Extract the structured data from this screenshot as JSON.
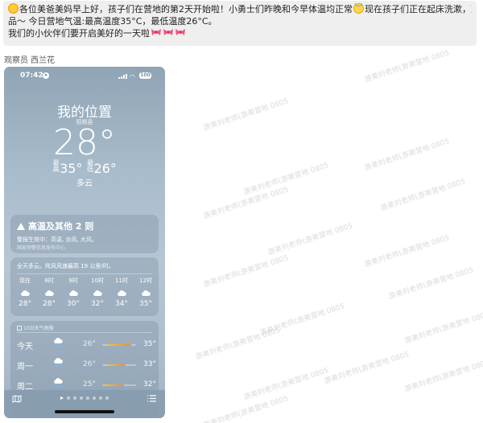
{
  "message": {
    "line1": "各位美爸美妈早上好，孩子们在营地的第2天开始啦！小勇士们昨晚和今早体温均正常",
    "line1b": "现在孩子们正在起床洗漱，准备上午所需物",
    "line2": "品～ 今日营地气温:最高温度35°C，最低温度26°C。",
    "line3": "我们的小伙伴们要开启美好的一天啦"
  },
  "sender": "观察员 西兰花",
  "phone": {
    "status": {
      "time": "07:42",
      "battery": "100"
    },
    "city": "我的位置",
    "subcity": "阳朔县",
    "temp": "28°",
    "high_label": "最高",
    "high": "35°",
    "low_label": "最低",
    "low": "26°",
    "condition": "多云",
    "alert": {
      "title": "高温及其他 2 则",
      "body": "警报生效中：高温, 台风, 大风。",
      "source": "国家预警信息发布中心"
    },
    "hourly": {
      "summary": "全天多云。阵风风速最高 19 公里/时。",
      "hours": [
        {
          "time": "现在",
          "temp": "28°"
        },
        {
          "time": "8时",
          "temp": "28°"
        },
        {
          "time": "9时",
          "temp": "30°"
        },
        {
          "time": "10时",
          "temp": "32°"
        },
        {
          "time": "11时",
          "temp": "34°"
        },
        {
          "time": "12时",
          "temp": "35°"
        }
      ]
    },
    "daily": {
      "header": "10日天气预报",
      "days": [
        {
          "name": "今天",
          "pct": "75%",
          "low": "26°",
          "high": "35°",
          "bar_start": 0.15,
          "bar_end": 0.85
        },
        {
          "name": "周一",
          "pct": "75%",
          "low": "26°",
          "high": "33°",
          "bar_start": 0.15,
          "bar_end": 0.7
        },
        {
          "name": "周二",
          "pct": "75%",
          "low": "25°",
          "high": "32°",
          "bar_start": 0.05,
          "bar_end": 0.65
        }
      ]
    }
  },
  "watermark": "游美刘老师(游美营地 0805",
  "colors": {
    "bubble": "#efefef",
    "phone_sky": "#a9bccb",
    "precip": "#6fc2ff",
    "bar_warm": "#f28a2e"
  },
  "icons": [
    "sun-emoji",
    "halo-face-emoji",
    "bow-emoji",
    "location-arrow-icon",
    "signal-icon",
    "wifi-icon",
    "battery-icon",
    "warning-icon",
    "cloud-icon",
    "calendar-icon",
    "map-icon",
    "list-icon"
  ]
}
